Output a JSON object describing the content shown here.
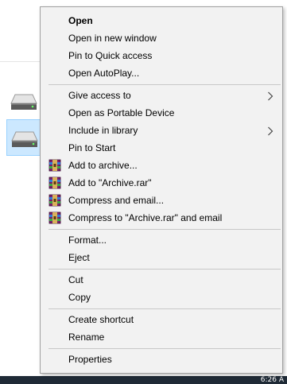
{
  "taskbar": {
    "clock": "6:26 A"
  },
  "context_menu": {
    "groups": [
      [
        {
          "label": "Open",
          "bold": true
        },
        {
          "label": "Open in new window"
        },
        {
          "label": "Pin to Quick access"
        },
        {
          "label": "Open AutoPlay..."
        }
      ],
      [
        {
          "label": "Give access to",
          "submenu": true
        },
        {
          "label": "Open as Portable Device"
        },
        {
          "label": "Include in library",
          "submenu": true
        },
        {
          "label": "Pin to Start"
        },
        {
          "label": "Add to archive...",
          "icon": "winrar-icon"
        },
        {
          "label": "Add to \"Archive.rar\"",
          "icon": "winrar-icon"
        },
        {
          "label": "Compress and email...",
          "icon": "winrar-icon"
        },
        {
          "label": "Compress to \"Archive.rar\" and email",
          "icon": "winrar-icon"
        }
      ],
      [
        {
          "label": "Format..."
        },
        {
          "label": "Eject"
        }
      ],
      [
        {
          "label": "Cut"
        },
        {
          "label": "Copy"
        }
      ],
      [
        {
          "label": "Create shortcut"
        },
        {
          "label": "Rename"
        }
      ],
      [
        {
          "label": "Properties"
        }
      ]
    ]
  },
  "colors": {
    "menu_background": "#f2f2f2",
    "selection_highlight": "#cce8ff",
    "taskbar": "#1f2a36"
  }
}
